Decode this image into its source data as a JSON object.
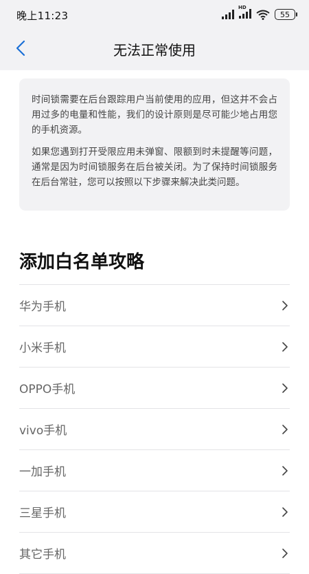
{
  "status_bar": {
    "time": "晚上11:23",
    "battery": "55"
  },
  "nav": {
    "title": "无法正常使用"
  },
  "info": {
    "paragraph1": "时间锁需要在后台跟踪用户当前使用的应用，但这并不会占用过多的电量和性能，我们的设计原则是尽可能少地占用您的手机资源。",
    "paragraph2": "如果您遇到打开受限应用未弹窗、限额到时未提醒等问题，通常是因为时间锁服务在后台被关闭。为了保持时间锁服务在后台常驻，您可以按照以下步骤来解决此类问题。"
  },
  "section": {
    "title": "添加白名单攻略"
  },
  "brands": [
    {
      "label": "华为手机"
    },
    {
      "label": "小米手机"
    },
    {
      "label": "OPPO手机"
    },
    {
      "label": "vivo手机"
    },
    {
      "label": "一加手机"
    },
    {
      "label": "三星手机"
    },
    {
      "label": "其它手机"
    }
  ],
  "icons": {
    "back": "chevron-left-icon",
    "row_arrow": "chevron-right-icon"
  },
  "colors": {
    "accent": "#1a6fd6",
    "card_bg": "#f2f2f4",
    "divider": "#e3e3e6"
  }
}
